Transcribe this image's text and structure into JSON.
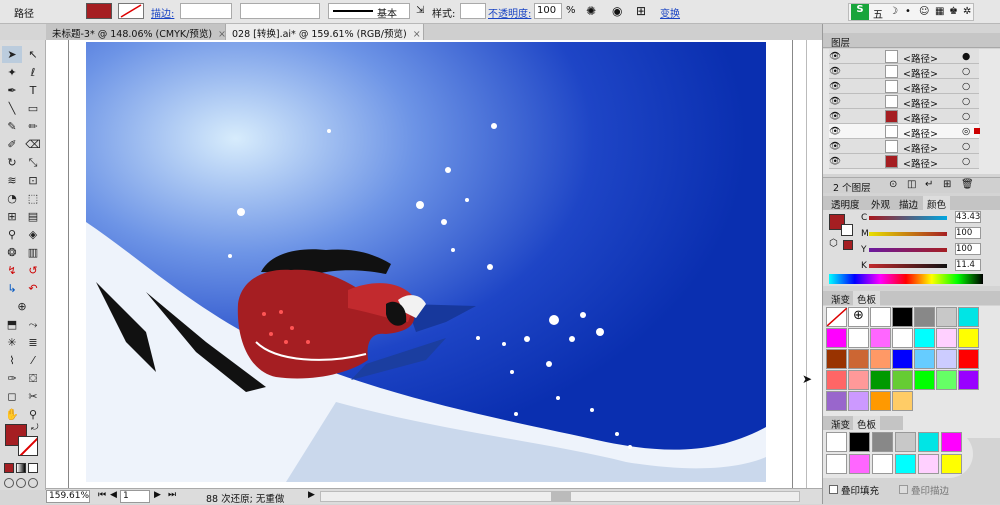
{
  "control_bar": {
    "selection_label": "路径",
    "stroke_label": "描边:",
    "line_preset": "基本",
    "style_label": "样式:",
    "opacity_label": "不透明度:",
    "opacity_value": "100",
    "percent": "%",
    "transform_label": "变换"
  },
  "tabs": [
    {
      "label": "未标题-3* @ 148.06% (CMYK/预览)",
      "close": "×"
    },
    {
      "label": "028 [转换].ai* @ 159.61% (RGB/预览)",
      "close": "×"
    }
  ],
  "status": {
    "zoom": "159.61%",
    "artboard": "1",
    "info": "88 次还原; 无重做"
  },
  "colors": {
    "accent_red": "#a51e22",
    "sky_dark": "#0a2fb0",
    "sky_light": "#c8e4fb",
    "fill_swatch": "#a51e22"
  },
  "ime": {
    "logo": "S",
    "label": "五"
  },
  "layers": {
    "title": "图层",
    "items": [
      "<路径>",
      "<路径>",
      "<路径>",
      "<路径>",
      "<路径>",
      "<路径>",
      "<路径>",
      "<路径>"
    ],
    "count_label": "2 个图层"
  },
  "appearance": {
    "tabs": [
      "透明度",
      "外观",
      "描边",
      "颜色"
    ],
    "channels": [
      {
        "name": "C",
        "value": "43.43",
        "color": "#00a7e1"
      },
      {
        "name": "M",
        "value": "100",
        "color": "#e5007f"
      },
      {
        "name": "Y",
        "value": "100",
        "color": "#ffe600"
      },
      {
        "name": "K",
        "value": "11.4",
        "color": "#222222"
      }
    ]
  },
  "swatches": {
    "tabs": [
      "渐变",
      "色板"
    ],
    "tabs_float": [
      "渐变",
      "色板"
    ],
    "row_colors": [
      "#ffffff",
      "#000000",
      "#888888",
      "#c8c8c8",
      "#00e5e5",
      "#ff00ff",
      "#ffffff",
      "#ff66ff",
      "#ffffff",
      "#00ffff",
      "#ffd0ff",
      "#ffff00",
      "#993300",
      "#cc6633",
      "#ff9966",
      "#0000ff",
      "#66ccff",
      "#ccccff",
      "#ff0000",
      "#ff6666",
      "#ff9999",
      "#009900",
      "#66cc33",
      "#00ff00",
      "#66ff66",
      "#9900ff",
      "#9966cc",
      "#cc99ff",
      "#ff9900",
      "#ffcc66"
    ]
  },
  "bottom_checks": {
    "fill": "叠印填充",
    "stroke": "叠印描边"
  }
}
